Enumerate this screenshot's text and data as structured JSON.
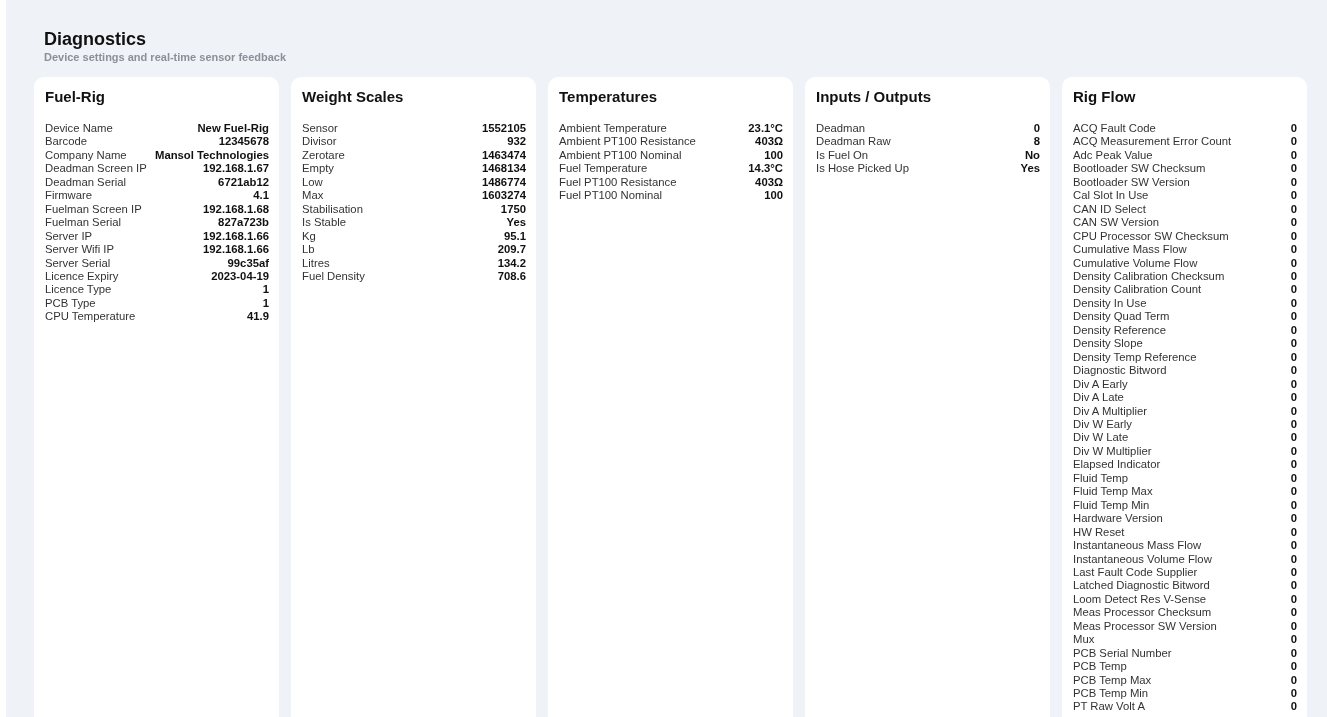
{
  "header": {
    "title": "Diagnostics",
    "subtitle": "Device settings and real-time sensor feedback"
  },
  "panels": [
    {
      "title": "Fuel-Rig",
      "rows": [
        [
          "Device Name",
          "New Fuel-Rig"
        ],
        [
          "Barcode",
          "12345678"
        ],
        [
          "Company Name",
          "Mansol Technologies"
        ],
        [
          "Deadman Screen IP",
          "192.168.1.67"
        ],
        [
          "Deadman Serial",
          "6721ab12"
        ],
        [
          "Firmware",
          "4.1"
        ],
        [
          "Fuelman Screen IP",
          "192.168.1.68"
        ],
        [
          "Fuelman Serial",
          "827a723b"
        ],
        [
          "Server IP",
          "192.168.1.66"
        ],
        [
          "Server Wifi IP",
          "192.168.1.66"
        ],
        [
          "Server Serial",
          "99c35af"
        ],
        [
          "Licence Expiry",
          "2023-04-19"
        ],
        [
          "Licence Type",
          "1"
        ],
        [
          "PCB Type",
          "1"
        ],
        [
          "CPU Temperature",
          "41.9"
        ]
      ]
    },
    {
      "title": "Weight Scales",
      "rows": [
        [
          "Sensor",
          "1552105"
        ],
        [
          "Divisor",
          "932"
        ],
        [
          "Zerotare",
          "1463474"
        ],
        [
          "Empty",
          "1468134"
        ],
        [
          "Low",
          "1486774"
        ],
        [
          "Max",
          "1603274"
        ],
        [
          "Stabilisation",
          "1750"
        ],
        [
          "Is Stable",
          "Yes"
        ],
        [
          "Kg",
          "95.1"
        ],
        [
          "Lb",
          "209.7"
        ],
        [
          "Litres",
          "134.2"
        ],
        [
          "Fuel Density",
          "708.6"
        ]
      ]
    },
    {
      "title": "Temperatures",
      "rows": [
        [
          "Ambient Temperature",
          "23.1°C"
        ],
        [
          "Ambient PT100 Resistance",
          "403Ω"
        ],
        [
          "Ambient PT100 Nominal",
          "100"
        ],
        [
          "Fuel Temperature",
          "14.3°C"
        ],
        [
          "Fuel PT100 Resistance",
          "403Ω"
        ],
        [
          "Fuel PT100 Nominal",
          "100"
        ]
      ]
    },
    {
      "title": "Inputs / Outputs",
      "rows": [
        [
          "Deadman",
          "0"
        ],
        [
          "Deadman Raw",
          "8"
        ],
        [
          "Is Fuel On",
          "No"
        ],
        [
          "Is Hose Picked Up",
          "Yes"
        ]
      ]
    },
    {
      "title": "Rig Flow",
      "rows": [
        [
          "ACQ Fault Code",
          "0"
        ],
        [
          "ACQ Measurement Error Count",
          "0"
        ],
        [
          "Adc Peak Value",
          "0"
        ],
        [
          "Bootloader SW Checksum",
          "0"
        ],
        [
          "Bootloader SW Version",
          "0"
        ],
        [
          "Cal Slot In Use",
          "0"
        ],
        [
          "CAN ID Select",
          "0"
        ],
        [
          "CAN SW Version",
          "0"
        ],
        [
          "CPU Processor SW Checksum",
          "0"
        ],
        [
          "Cumulative Mass Flow",
          "0"
        ],
        [
          "Cumulative Volume Flow",
          "0"
        ],
        [
          "Density Calibration Checksum",
          "0"
        ],
        [
          "Density Calibration Count",
          "0"
        ],
        [
          "Density In Use",
          "0"
        ],
        [
          "Density Quad Term",
          "0"
        ],
        [
          "Density Reference",
          "0"
        ],
        [
          "Density Slope",
          "0"
        ],
        [
          "Density Temp Reference",
          "0"
        ],
        [
          "Diagnostic Bitword",
          "0"
        ],
        [
          "Div A Early",
          "0"
        ],
        [
          "Div A Late",
          "0"
        ],
        [
          "Div A Multiplier",
          "0"
        ],
        [
          "Div W Early",
          "0"
        ],
        [
          "Div W Late",
          "0"
        ],
        [
          "Div W Multiplier",
          "0"
        ],
        [
          "Elapsed Indicator",
          "0"
        ],
        [
          "Fluid Temp",
          "0"
        ],
        [
          "Fluid Temp Max",
          "0"
        ],
        [
          "Fluid Temp Min",
          "0"
        ],
        [
          "Hardware Version",
          "0"
        ],
        [
          "HW Reset",
          "0"
        ],
        [
          "Instantaneous Mass Flow",
          "0"
        ],
        [
          "Instantaneous Volume Flow",
          "0"
        ],
        [
          "Last Fault Code Supplier",
          "0"
        ],
        [
          "Latched Diagnostic Bitword",
          "0"
        ],
        [
          "Loom Detect Res V-Sense",
          "0"
        ],
        [
          "Meas Processor Checksum",
          "0"
        ],
        [
          "Meas Processor SW Version",
          "0"
        ],
        [
          "Mux",
          "0"
        ],
        [
          "PCB Serial Number",
          "0"
        ],
        [
          "PCB Temp",
          "0"
        ],
        [
          "PCB Temp Max",
          "0"
        ],
        [
          "PCB Temp Min",
          "0"
        ],
        [
          "PT Raw Volt A",
          "0"
        ]
      ]
    }
  ]
}
